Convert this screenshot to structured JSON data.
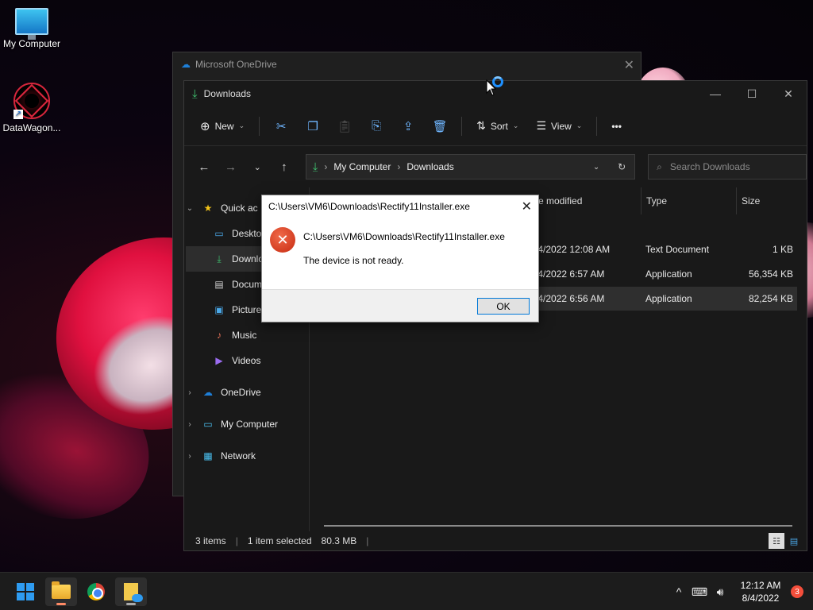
{
  "desktop": {
    "icons": [
      {
        "label": "My Computer"
      },
      {
        "label": "DataWagon..."
      }
    ]
  },
  "onedrive_window": {
    "title": "Microsoft OneDrive"
  },
  "explorer": {
    "title": "Downloads",
    "window_controls": {
      "minimize": "—",
      "maximize": "☐",
      "close": "✕"
    },
    "toolbar": {
      "new_label": "New",
      "sort_label": "Sort",
      "view_label": "View",
      "more_label": "•••"
    },
    "address": {
      "segments": [
        "My Computer",
        "Downloads"
      ],
      "separator": "›"
    },
    "search": {
      "placeholder": "Search Downloads"
    },
    "nav_pane": [
      {
        "label": "Quick ac",
        "chev": "⌄",
        "icon": "star-icon"
      },
      {
        "label": "Desktop",
        "icon": "desktop-icon"
      },
      {
        "label": "Downlo",
        "icon": "download-icon",
        "selected": true
      },
      {
        "label": "Docum",
        "icon": "document-icon"
      },
      {
        "label": "Picture",
        "icon": "picture-icon"
      },
      {
        "label": "Music",
        "icon": "music-icon"
      },
      {
        "label": "Videos",
        "icon": "video-icon"
      },
      {
        "label": "OneDrive",
        "chev": "›",
        "icon": "cloud-icon"
      },
      {
        "label": "My Computer",
        "chev": "›",
        "icon": "computer-icon"
      },
      {
        "label": "Network",
        "chev": "›",
        "icon": "network-icon"
      }
    ],
    "columns": {
      "date_modified": "ate modified",
      "type": "Type",
      "size": "Size"
    },
    "files": [
      {
        "date": "/4/2022 12:08 AM",
        "type": "Text Document",
        "size": "1 KB"
      },
      {
        "date": "/4/2022 6:57 AM",
        "type": "Application",
        "size": "56,354 KB"
      },
      {
        "date": "/4/2022 6:56 AM",
        "type": "Application",
        "size": "82,254 KB",
        "selected": true
      }
    ],
    "status": {
      "items": "3 items",
      "selected": "1 item selected",
      "size": "80.3 MB"
    }
  },
  "dialog": {
    "title": "C:\\Users\\VM6\\Downloads\\Rectify11Installer.exe",
    "path": "C:\\Users\\VM6\\Downloads\\Rectify11Installer.exe",
    "message": "The device is not ready.",
    "ok_label": "OK",
    "close": "✕",
    "error_icon": "✕"
  },
  "taskbar": {
    "time": "12:12 AM",
    "date": "8/4/2022",
    "notification_count": "3",
    "tray_chevron": "^"
  },
  "colors": {
    "accent": "#2e9bf0",
    "error": "#c72a10",
    "download_green": "#3fbf6e"
  }
}
